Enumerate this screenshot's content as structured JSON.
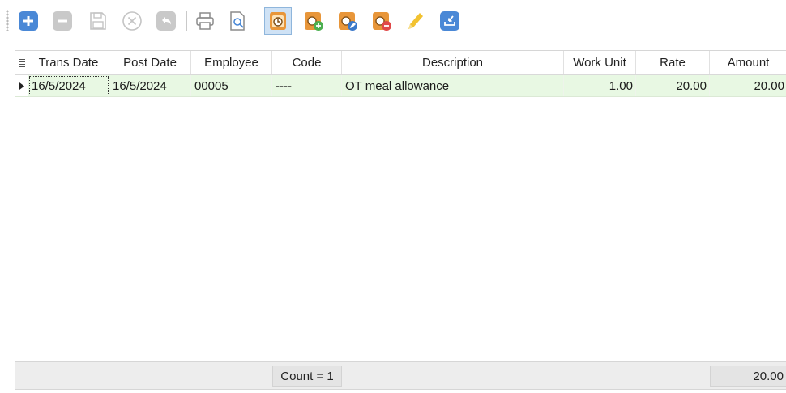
{
  "toolbar": {
    "buttons": [
      {
        "name": "add-icon",
        "color": "#4a88d6"
      },
      {
        "name": "remove-icon",
        "color": "#c4c4c4"
      },
      {
        "name": "save-icon",
        "color": "#c4c4c4"
      },
      {
        "name": "cancel-icon",
        "color": "#c4c4c4"
      },
      {
        "name": "undo-icon",
        "color": "#c4c4c4"
      },
      {
        "name": "print-icon",
        "color": "#8b8b8b"
      },
      {
        "name": "print-preview-icon",
        "color": "#8b8b8b"
      },
      {
        "name": "timesheet-icon",
        "color": "#e8963a"
      },
      {
        "name": "timesheet-add-icon",
        "color": "#e8963a"
      },
      {
        "name": "timesheet-edit-icon",
        "color": "#e8963a"
      },
      {
        "name": "timesheet-delete-icon",
        "color": "#e8963a"
      },
      {
        "name": "highlight-pen-icon",
        "color": "#f2c230"
      },
      {
        "name": "import-icon",
        "color": "#4a88d6"
      }
    ]
  },
  "grid": {
    "columns": [
      "Trans Date",
      "Post Date",
      "Employee",
      "Code",
      "Description",
      "Work Unit",
      "Rate",
      "Amount"
    ],
    "rows": [
      {
        "trans_date": "16/5/2024",
        "post_date": "16/5/2024",
        "employee": "00005",
        "code": "----",
        "description": "OT meal allowance",
        "work_unit": "1.00",
        "rate": "20.00",
        "amount": "20.00"
      }
    ],
    "footer": {
      "count": "Count = 1",
      "amount_total": "20.00"
    }
  },
  "colors": {
    "row_bg": "#e8f8e3",
    "accent": "#4a88d6"
  }
}
